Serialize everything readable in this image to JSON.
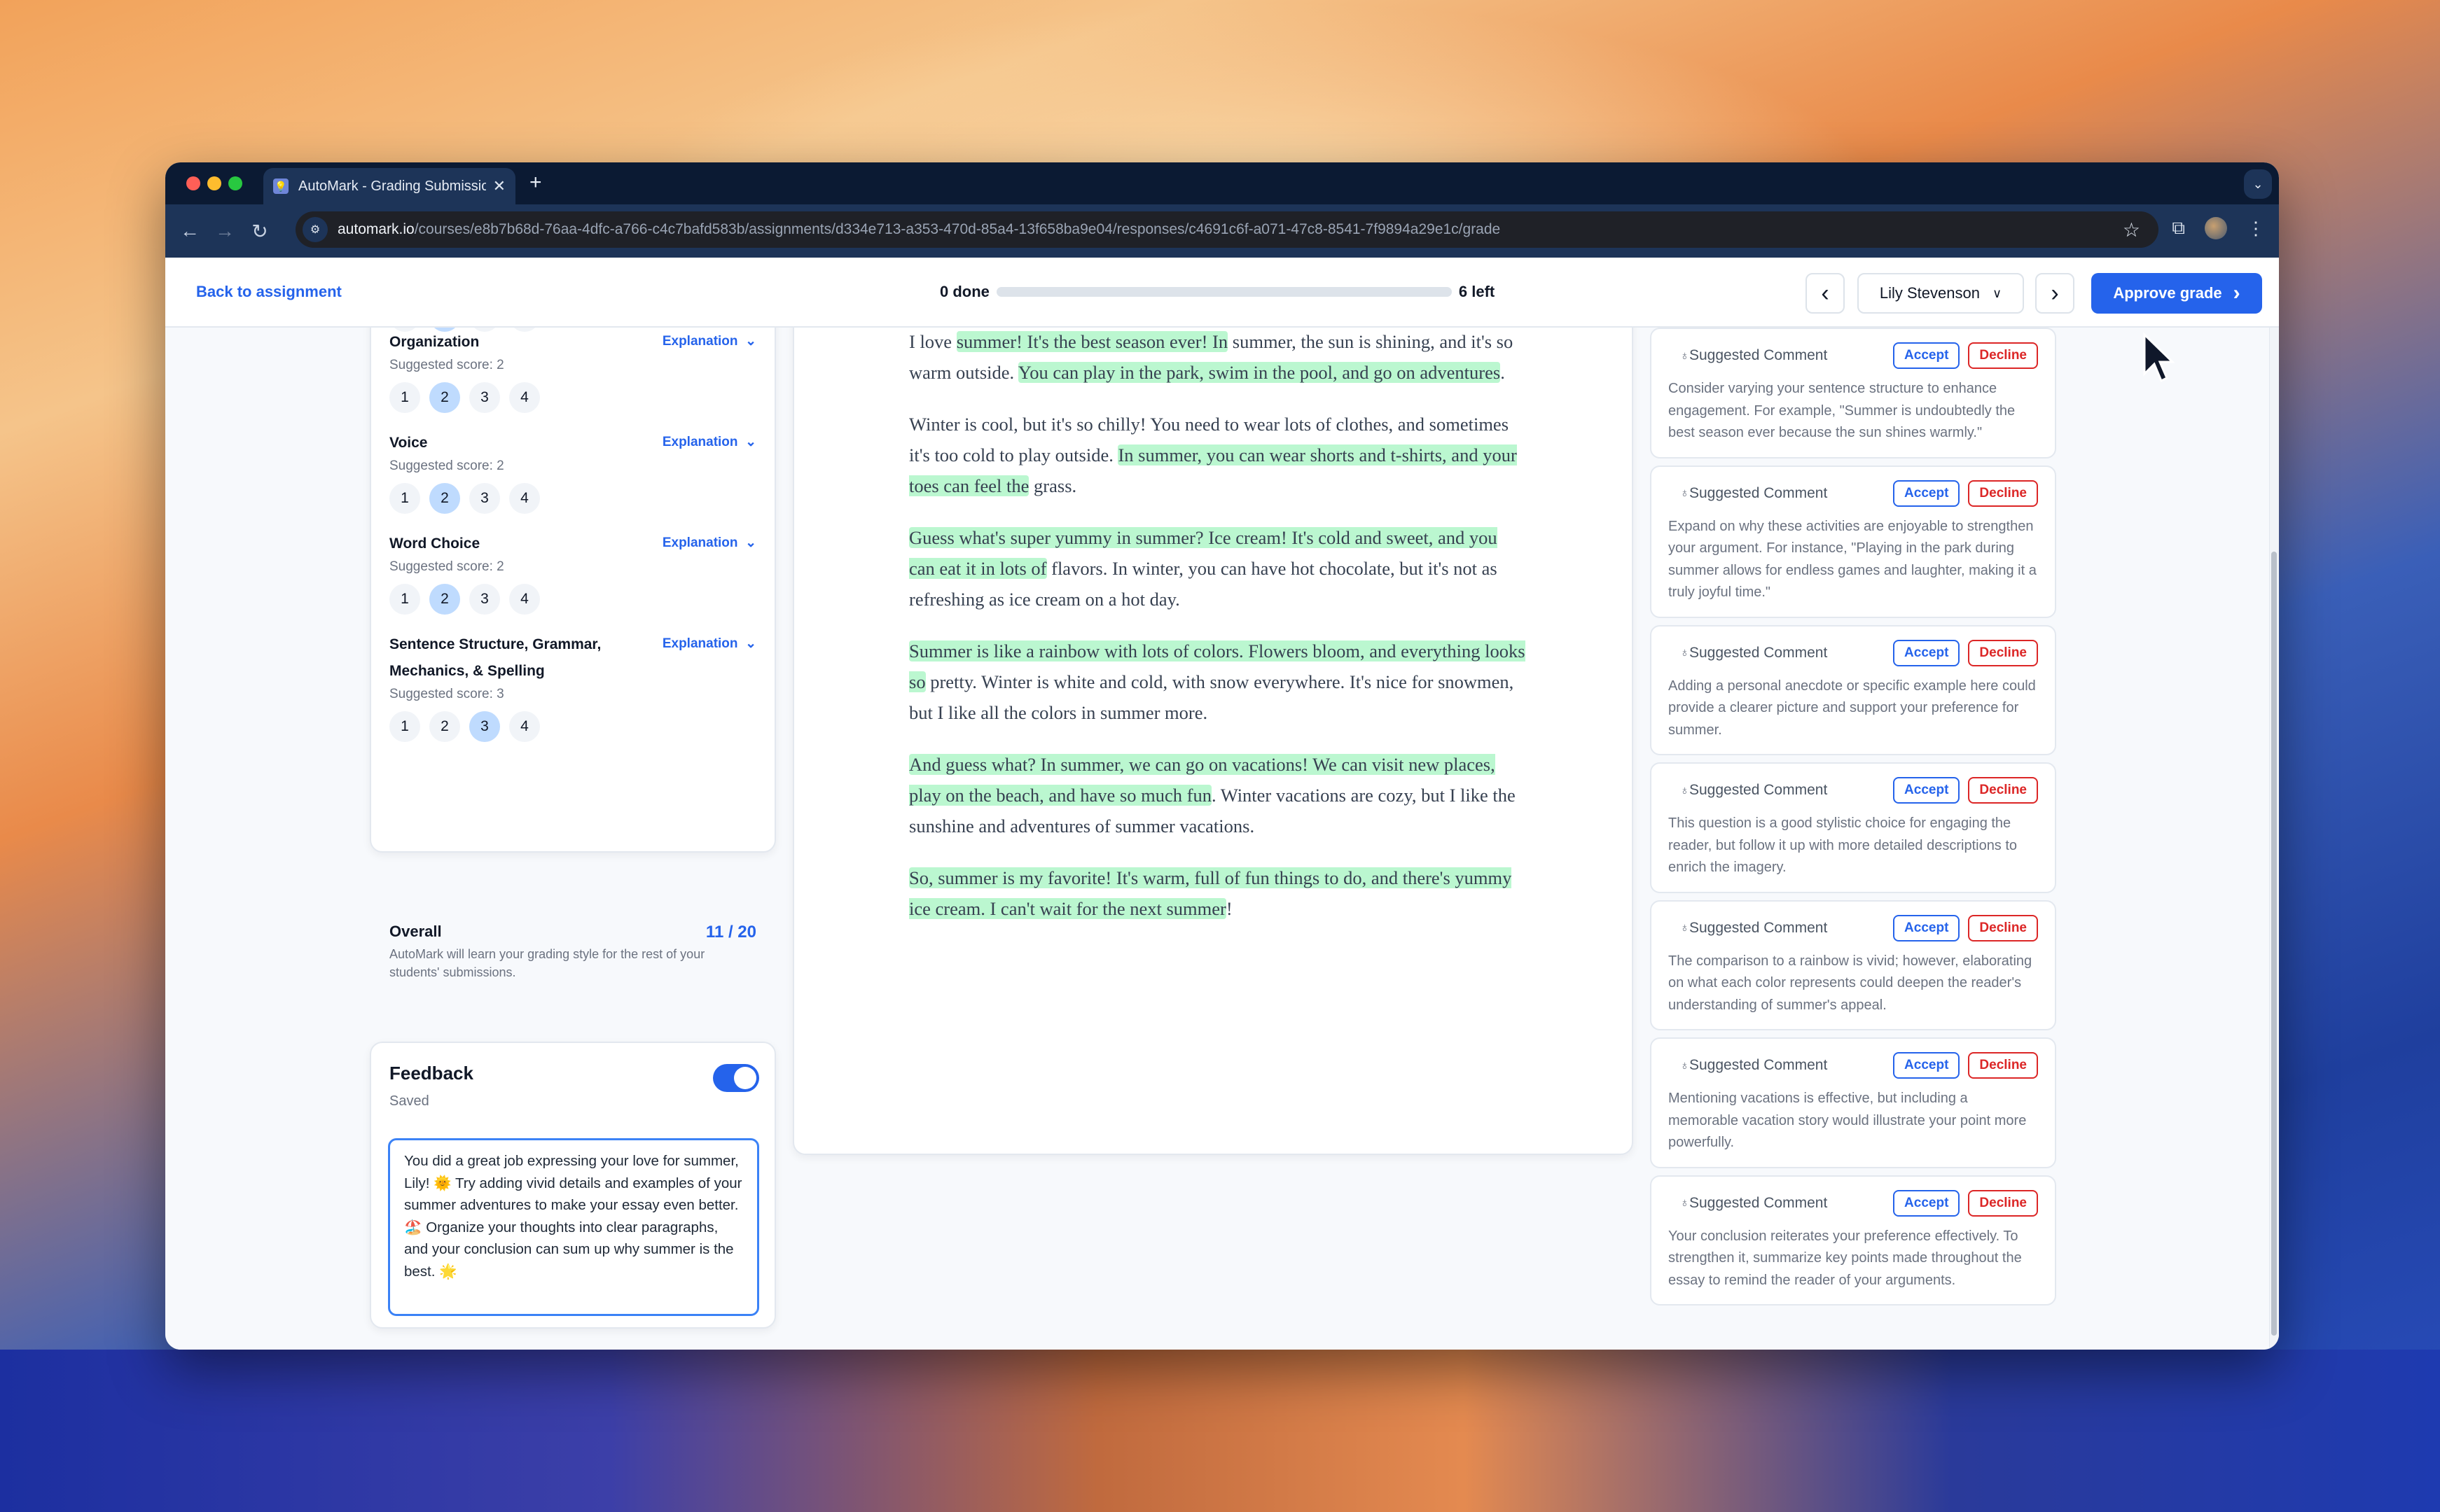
{
  "browser": {
    "tab_title": "AutoMark - Grading Submission",
    "url_host": "automark.io",
    "url_path": "/courses/e8b7b68d-76aa-4dfc-a766-c4c7bafd583b/assignments/d334e713-a353-470d-85a4-13f658ba9e04/responses/c4691c6f-a071-47c8-8541-7f9894a29e1c/grade",
    "new_tab_glyph": "+",
    "close_glyph": "✕"
  },
  "header": {
    "back_label": "Back to assignment",
    "done_label": "0 done",
    "left_label": "6 left",
    "progress_fraction": 0,
    "student_name": "Lily Stevenson",
    "prev_glyph": "‹",
    "next_glyph": "›",
    "approve_label": "Approve grade"
  },
  "rubric": {
    "explanation_label": "Explanation",
    "criteria": [
      {
        "name": "Organization",
        "suggested": "Suggested score: 2",
        "selected": 2,
        "options": [
          "1",
          "2",
          "3",
          "4"
        ]
      },
      {
        "name": "Voice",
        "suggested": "Suggested score: 2",
        "selected": 2,
        "options": [
          "1",
          "2",
          "3",
          "4"
        ]
      },
      {
        "name": "Word Choice",
        "suggested": "Suggested score: 2",
        "selected": 2,
        "options": [
          "1",
          "2",
          "3",
          "4"
        ]
      },
      {
        "name": "Sentence Structure, Grammar, Mechanics, & Spelling",
        "suggested": "Suggested score: 3",
        "selected": 3,
        "options": [
          "1",
          "2",
          "3",
          "4"
        ]
      }
    ],
    "overall_label": "Overall",
    "overall_score": "11 / 20",
    "overall_note": "AutoMark will learn your grading style for the rest of your students' submissions."
  },
  "feedback": {
    "title": "Feedback",
    "status": "Saved",
    "enabled": true,
    "text": "You did a great job expressing your love for summer, Lily! 🌞 Try adding vivid details and examples of your summer adventures to make your essay even better. 🏖️ Organize your thoughts into clear paragraphs, and your conclusion can sum up why summer is the best. 🌟"
  },
  "essay": {
    "paragraphs": [
      [
        {
          "t": "I love ",
          "h": false
        },
        {
          "t": "summer! It's the best season ever! In",
          "h": true
        },
        {
          "t": " summer, the sun is shining, and it's so warm outside. ",
          "h": false
        },
        {
          "t": "You can play in the park, swim in the pool, and go on adventures",
          "h": true
        },
        {
          "t": ".",
          "h": false
        }
      ],
      [
        {
          "t": "Winter is cool, but it's so chilly! You need to wear lots of clothes, and sometimes it's too cold to play outside. ",
          "h": false
        },
        {
          "t": "In summer, you can wear shorts and t-shirts, and your toes can feel the",
          "h": true
        },
        {
          "t": " grass.",
          "h": false
        }
      ],
      [
        {
          "t": "Guess what's super yummy in summer? Ice cream! It's cold and sweet, and you can eat it in lots of",
          "h": true
        },
        {
          "t": " flavors. In winter, you can have hot chocolate, but it's not as refreshing as ice cream on a hot day.",
          "h": false
        }
      ],
      [
        {
          "t": "Summer is like a rainbow with lots of colors. Flowers bloom, and everything looks so",
          "h": true
        },
        {
          "t": " pretty. Winter is white and cold, with snow everywhere. It's nice for snowmen, but I like all the colors in summer more.",
          "h": false
        }
      ],
      [
        {
          "t": "And guess what? In summer, we can go on vacations! We can visit new places, play on the beach, and have so much fun",
          "h": true
        },
        {
          "t": ". Winter vacations are cozy, but I like the sunshine and adventures of summer vacations.",
          "h": false
        }
      ],
      [
        {
          "t": "So, summer is my favorite! It's warm, full of fun things to do, and there's yummy ice cream. I can't wait for the next summer",
          "h": true
        },
        {
          "t": "!",
          "h": false
        }
      ]
    ]
  },
  "comments": {
    "label": "Suggested Comment",
    "accept_label": "Accept",
    "decline_label": "Decline",
    "items": [
      "Consider varying your sentence structure to enhance engagement. For example, \"Summer is undoubtedly the best season ever because the sun shines warmly.\"",
      "Expand on why these activities are enjoyable to strengthen your argument. For instance, \"Playing in the park during summer allows for endless games and laughter, making it a truly joyful time.\"",
      "Adding a personal anecdote or specific example here could provide a clearer picture and support your preference for summer.",
      "This question is a good stylistic choice for engaging the reader, but follow it up with more detailed descriptions to enrich the imagery.",
      "The comparison to a rainbow is vivid; however, elaborating on what each color represents could deepen the reader's understanding of summer's appeal.",
      "Mentioning vacations is effective, but including a memorable vacation story would illustrate your point more powerfully.",
      "Your conclusion reiterates your preference effectively. To strengthen it, summarize key points made throughout the essay to remind the reader of your arguments."
    ]
  },
  "colors": {
    "accent": "#2563eb",
    "decline": "#dc2626",
    "highlight": "#bbf7d0",
    "selected_score": "#bfdbfe"
  }
}
